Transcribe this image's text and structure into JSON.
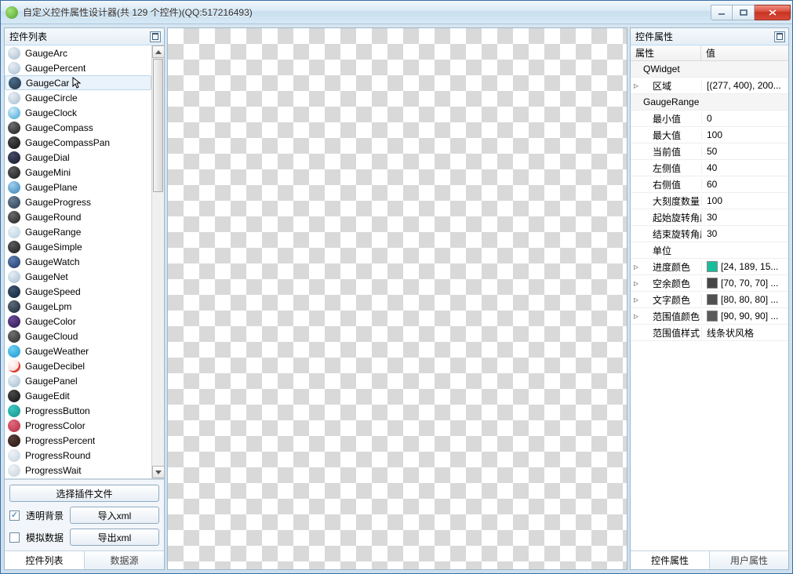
{
  "window": {
    "title": "自定义控件属性设计器(共 129 个控件)(QQ:517216493)"
  },
  "left_panel": {
    "header": "控件列表",
    "items": [
      {
        "label": "GaugeArc",
        "color_a": "#e8eef3",
        "color_b": "#a6bdd0",
        "selected": false
      },
      {
        "label": "GaugePercent",
        "color_a": "#e8eef3",
        "color_b": "#a6bdd0",
        "selected": false
      },
      {
        "label": "GaugeCar",
        "color_a": "#4a6b88",
        "color_b": "#223648",
        "selected": true
      },
      {
        "label": "GaugeCircle",
        "color_a": "#e8eef3",
        "color_b": "#a6bdd0",
        "selected": false
      },
      {
        "label": "GaugeClock",
        "color_a": "#cdeaf7",
        "color_b": "#3fa6d8",
        "selected": false
      },
      {
        "label": "GaugeCompass",
        "color_a": "#6d6d6d",
        "color_b": "#1c1c1c",
        "selected": false
      },
      {
        "label": "GaugeCompassPan",
        "color_a": "#4a4a4a",
        "color_b": "#111111",
        "selected": false
      },
      {
        "label": "GaugeDial",
        "color_a": "#444b66",
        "color_b": "#14182a",
        "selected": false
      },
      {
        "label": "GaugeMini",
        "color_a": "#5a5a5a",
        "color_b": "#1a1a1a",
        "selected": false
      },
      {
        "label": "GaugePlane",
        "color_a": "#9fd0ef",
        "color_b": "#3a7fb3",
        "selected": false
      },
      {
        "label": "GaugeProgress",
        "color_a": "#6a7f95",
        "color_b": "#2a3d52",
        "selected": false
      },
      {
        "label": "GaugeRound",
        "color_a": "#6a6a6a",
        "color_b": "#222222",
        "selected": false
      },
      {
        "label": "GaugeRange",
        "color_a": "#e8f1f6",
        "color_b": "#b7d0e0",
        "selected": false
      },
      {
        "label": "GaugeSimple",
        "color_a": "#5a5a5a",
        "color_b": "#1a1a1a",
        "selected": false
      },
      {
        "label": "GaugeWatch",
        "color_a": "#5e7eb3",
        "color_b": "#1e3766",
        "selected": false
      },
      {
        "label": "GaugeNet",
        "color_a": "#e6eef4",
        "color_b": "#a6bdd0",
        "selected": false
      },
      {
        "label": "GaugeSpeed",
        "color_a": "#3d5470",
        "color_b": "#102238",
        "selected": false
      },
      {
        "label": "GaugeLpm",
        "color_a": "#5a6a7a",
        "color_b": "#1a2634",
        "selected": false
      },
      {
        "label": "GaugeColor",
        "color_a": "#6a4a9a",
        "color_b": "#2a1646",
        "selected": false
      },
      {
        "label": "GaugeCloud",
        "color_a": "#707070",
        "color_b": "#2a2a2a",
        "selected": false
      },
      {
        "label": "GaugeWeather",
        "color_a": "#6bcff2",
        "color_b": "#1c98d2",
        "selected": false
      },
      {
        "label": "GaugeDecibel",
        "color_a": "#ffffff",
        "color_b": "#f7c3bf",
        "accent": "#e23b2e",
        "selected": false
      },
      {
        "label": "GaugePanel",
        "color_a": "#e4edf3",
        "color_b": "#a2bccf",
        "selected": false
      },
      {
        "label": "GaugeEdit",
        "color_a": "#4a4a4a",
        "color_b": "#101010",
        "selected": false
      },
      {
        "label": "ProgressButton",
        "color_a": "#3ec6bf",
        "color_b": "#13938c",
        "selected": false
      },
      {
        "label": "ProgressColor",
        "color_a": "#e06a7a",
        "color_b": "#b42a44",
        "selected": false
      },
      {
        "label": "ProgressPercent",
        "color_a": "#5a3f3a",
        "color_b": "#241410",
        "selected": false
      },
      {
        "label": "ProgressRound",
        "color_a": "#eef2f5",
        "color_b": "#c3d2dd",
        "selected": false
      },
      {
        "label": "ProgressWait",
        "color_a": "#eef2f5",
        "color_b": "#c3d2dd",
        "selected": false
      }
    ],
    "buttons": {
      "select_plugin": "选择插件文件",
      "import_xml": "导入xml",
      "export_xml": "导出xml"
    },
    "checks": {
      "transparent_bg": {
        "label": "透明背景",
        "checked": true
      },
      "simulate_data": {
        "label": "模拟数据",
        "checked": false
      }
    },
    "bottom_tabs": {
      "list": "控件列表",
      "datasource": "数据源",
      "active": "list"
    }
  },
  "right_panel": {
    "header": "控件属性",
    "columns": {
      "name": "属性",
      "value": "值"
    },
    "groups": [
      {
        "name": "QWidget",
        "rows": [
          {
            "name": "区域",
            "value": "[(277, 400), 200...",
            "twisty": "right"
          }
        ]
      },
      {
        "name": "GaugeRange",
        "rows": [
          {
            "name": "最小值",
            "value": "0"
          },
          {
            "name": "最大值",
            "value": "100"
          },
          {
            "name": "当前值",
            "value": "50"
          },
          {
            "name": "左侧值",
            "value": "40"
          },
          {
            "name": "右侧值",
            "value": "60"
          },
          {
            "name": "大刻度数量",
            "value": "100"
          },
          {
            "name": "起始旋转角度",
            "value": "30"
          },
          {
            "name": "结束旋转角度",
            "value": "30"
          },
          {
            "name": "单位",
            "value": ""
          },
          {
            "name": "进度颜色",
            "value": "[24, 189, 15...",
            "color": "#18bd9b",
            "twisty": "right"
          },
          {
            "name": "空余颜色",
            "value": "[70, 70, 70] ...",
            "color": "#464646",
            "twisty": "right"
          },
          {
            "name": "文字颜色",
            "value": "[80, 80, 80] ...",
            "color": "#505050",
            "twisty": "right"
          },
          {
            "name": "范围值颜色",
            "value": "[90, 90, 90] ...",
            "color": "#5a5a5a",
            "twisty": "right"
          },
          {
            "name": "范围值样式",
            "value": "线条状风格"
          }
        ]
      }
    ],
    "bottom_tabs": {
      "ctrl": "控件属性",
      "user": "用户属性",
      "active": "ctrl"
    }
  }
}
